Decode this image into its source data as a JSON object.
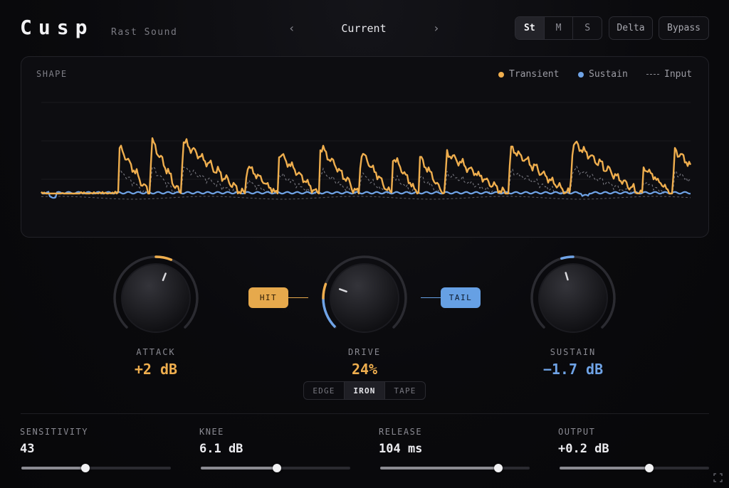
{
  "header": {
    "brand": "Cusp",
    "maker": "Rast Sound",
    "preset_prev_icon": "chevron-left-icon",
    "preset_name": "Current",
    "preset_next_icon": "chevron-right-icon",
    "stereo_modes": [
      {
        "label": "St",
        "active": true
      },
      {
        "label": "M",
        "active": false
      },
      {
        "label": "S",
        "active": false
      }
    ],
    "delta_label": "Delta",
    "bypass_label": "Bypass"
  },
  "shape": {
    "title": "SHAPE",
    "legend": {
      "transient": "Transient",
      "sustain": "Sustain",
      "input": "Input"
    }
  },
  "colors": {
    "transient": "#efae4e",
    "sustain": "#6fa3e6",
    "input": "#8a8a92",
    "ring_track": "#2b2b31"
  },
  "knobs": {
    "attack": {
      "label": "ATTACK",
      "value": "+2 dB",
      "level": 0.58
    },
    "drive": {
      "label": "DRIVE",
      "value": "24%",
      "level": 0.24
    },
    "sustain": {
      "label": "SUSTAIN",
      "value": "−1.7 dB",
      "level": 0.44
    }
  },
  "tags": {
    "hit": "HIT",
    "tail": "TAIL"
  },
  "drive_modes": [
    {
      "label": "EDGE",
      "active": false
    },
    {
      "label": "IRON",
      "active": true
    },
    {
      "label": "TAPE",
      "active": false
    }
  ],
  "params": {
    "sensitivity": {
      "label": "SENSITIVITY",
      "value": "43",
      "level": 0.43
    },
    "knee": {
      "label": "KNEE",
      "value": "6.1 dB",
      "level": 0.51
    },
    "release": {
      "label": "RELEASE",
      "value": "104 ms",
      "level": 0.79
    },
    "output": {
      "label": "OUTPUT",
      "value": "+0.2 dB",
      "level": 0.6
    }
  },
  "footer": {
    "resize_icon": "resize-icon"
  }
}
